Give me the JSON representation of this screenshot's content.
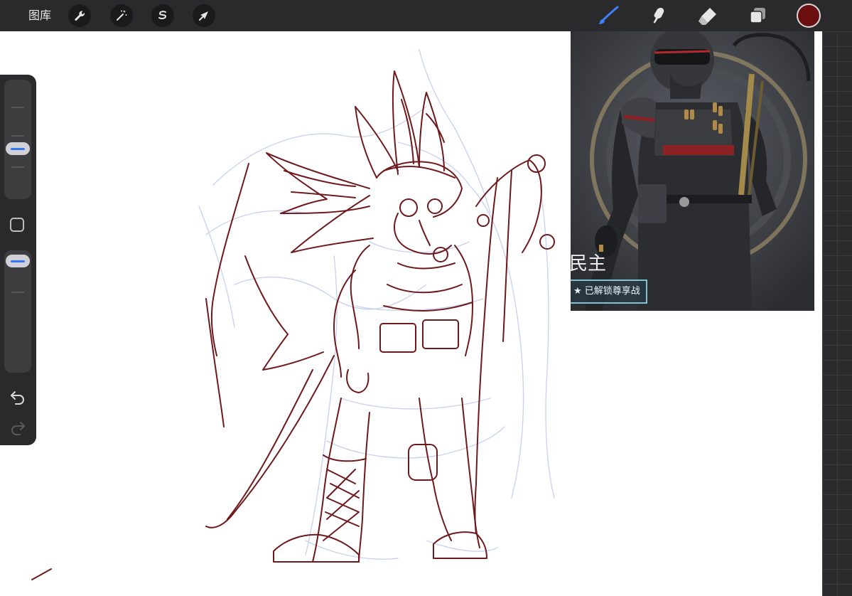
{
  "toolbar": {
    "gallery_label": "图库",
    "left_tools": [
      {
        "name": "wrench-icon",
        "purpose": "actions"
      },
      {
        "name": "magic-wand-icon",
        "purpose": "adjustments"
      },
      {
        "name": "selection-icon",
        "purpose": "selection"
      },
      {
        "name": "arrow-cursor-icon",
        "purpose": "transform"
      }
    ],
    "right_tools": [
      {
        "name": "brush-icon",
        "active": true,
        "color": "#3b82f6"
      },
      {
        "name": "smudge-icon",
        "active": false
      },
      {
        "name": "eraser-icon",
        "active": false
      },
      {
        "name": "layers-icon",
        "active": false
      }
    ],
    "current_color": "#6a0e10"
  },
  "reference_window": {
    "caption": "民主",
    "badge_text": "★ 已解锁尊享战"
  },
  "sidebar": {
    "brush_size_level": 0.55,
    "opacity_level": 0.9,
    "modify_button_icon": "square-icon",
    "undo_icon": "undo-icon",
    "redo_icon": "redo-icon"
  },
  "colors": {
    "toolbar_bg": "#2a2a2c",
    "accent": "#3478f6",
    "sketch_stroke": "#6e1a1c",
    "rough_stroke": "#b9c6e8"
  }
}
